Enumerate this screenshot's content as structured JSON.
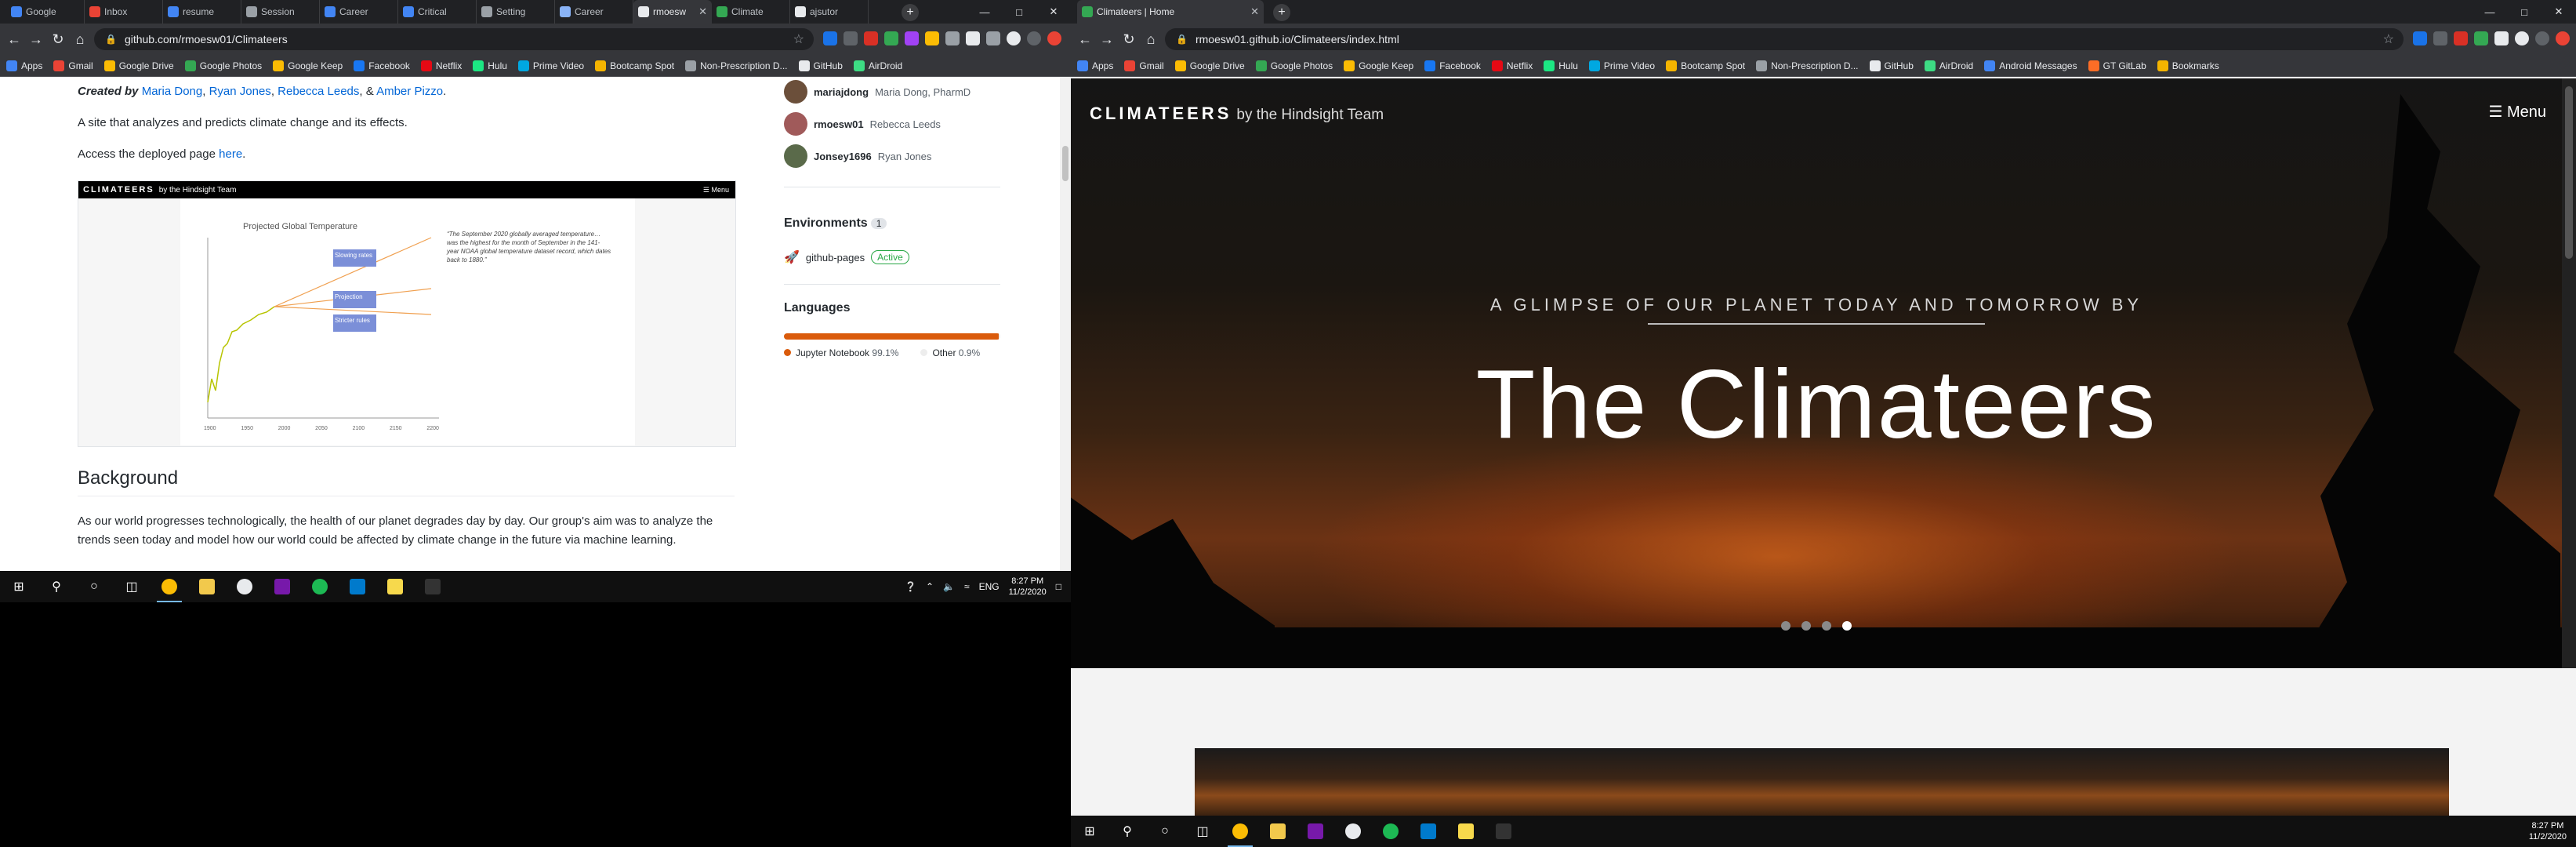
{
  "left_browser": {
    "tabs": [
      {
        "label": "Google",
        "color": "#4285f4"
      },
      {
        "label": "Inbox",
        "color": "#ea4335"
      },
      {
        "label": "resume",
        "color": "#4285f4"
      },
      {
        "label": "Session",
        "color": "#9aa0a6"
      },
      {
        "label": "Career",
        "color": "#4285f4"
      },
      {
        "label": "Critical",
        "color": "#4285f4"
      },
      {
        "label": "Setting",
        "color": "#9aa0a6"
      },
      {
        "label": "Career",
        "color": "#8ab4f8"
      },
      {
        "label": "rmoesw",
        "color": "#e8eaed"
      },
      {
        "label": "Climate",
        "color": "#34a853"
      },
      {
        "label": "ajsutor",
        "color": "#e8eaed"
      }
    ],
    "url": "github.com/rmoesw01/Climateers"
  },
  "right_browser": {
    "tabs": [
      {
        "label": "Climateers | Home",
        "color": "#34a853"
      }
    ],
    "url": "rmoesw01.github.io/Climateers/index.html"
  },
  "bookmarks_left": [
    "Apps",
    "Gmail",
    "Google Drive",
    "Google Photos",
    "Google Keep",
    "Facebook",
    "Netflix",
    "Hulu",
    "Prime Video",
    "Bootcamp Spot",
    "Non-Prescription D...",
    "GitHub",
    "AirDroid"
  ],
  "bookmarks_right": [
    "Apps",
    "Gmail",
    "Google Drive",
    "Google Photos",
    "Google Keep",
    "Facebook",
    "Netflix",
    "Hulu",
    "Prime Video",
    "Bootcamp Spot",
    "Non-Prescription D...",
    "GitHub",
    "AirDroid",
    "Android Messages",
    "GT GitLab",
    "Bookmarks"
  ],
  "readme": {
    "created_by_prefix": "Created by",
    "authors": [
      "Maria Dong",
      "Ryan Jones",
      "Rebecca Leeds",
      "Amber Pizzo"
    ],
    "sep1": ",",
    "sep3": ", &",
    "end": ".",
    "description": "A site that analyzes and predicts climate change and its effects.",
    "access_prefix": "Access the deployed page",
    "access_link": "here",
    "screenshot": {
      "brand": "CLIMATEERS",
      "brand_sub": "by the Hindsight Team",
      "menu": "☰ Menu",
      "chart_title": "Projected Global Temperature",
      "quote": "“The September 2020 globally averaged temperature… was the highest for the month of September in the 141-year NOAA global temperature dataset record, which dates back to 1880.”",
      "labels": [
        "Slowing rates",
        "Projection",
        "Stricter rules"
      ],
      "ticks": [
        "1900",
        "1950",
        "2000",
        "2050",
        "2100",
        "2150",
        "2200"
      ]
    },
    "background_heading": "Background",
    "background_text": "As our world progresses technologically, the health of our planet degrades day by day. Our group's aim was to analyze the trends seen today and model how our world could be affected by climate change in the future via machine learning."
  },
  "sidebar": {
    "contributors": [
      {
        "user": "mariajdong",
        "name": "Maria Dong, PharmD"
      },
      {
        "user": "rmoesw01",
        "name": "Rebecca Leeds"
      },
      {
        "user": "Jonsey1696",
        "name": "Ryan Jones"
      }
    ],
    "environments_heading": "Environments",
    "environments_count": "1",
    "environment": "github-pages",
    "environment_status": "Active",
    "languages_heading": "Languages",
    "languages": [
      {
        "name": "Jupyter Notebook",
        "percent": "99.1%",
        "value": 99.1,
        "color": "#da5b0b"
      },
      {
        "name": "Other",
        "percent": "0.9%",
        "value": 0.9,
        "color": "#ededed"
      }
    ]
  },
  "taskbar_left": {
    "time": "8:27 PM",
    "date": "11/2/2020",
    "lang": "ENG"
  },
  "taskbar_right": {
    "time": "8:27 PM",
    "date": "11/2/2020"
  },
  "hero": {
    "brand": "CLIMATEERS",
    "brand_sub": "by the Hindsight Team",
    "menu": "☰ Menu",
    "subtitle": "A GLIMPSE OF OUR PLANET TODAY AND TOMORROW BY",
    "title": "The Climateers",
    "slides": 4,
    "active_slide": 4
  }
}
